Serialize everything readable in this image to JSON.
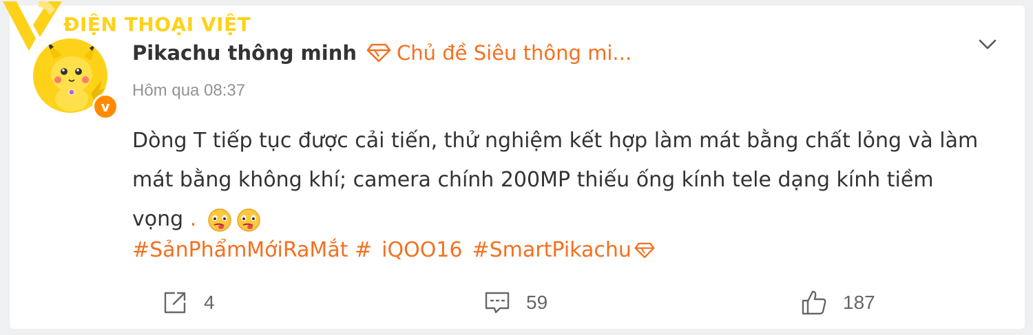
{
  "watermark": {
    "text": "ĐIỆN THOẠI VIỆT"
  },
  "post": {
    "username": "Pikachu thông minh",
    "topic": "Chủ đề Siêu thông mi...",
    "timestamp": "Hôm qua 08:37",
    "verified_badge": "v",
    "body_lines": [
      "Dòng T tiếp tục được cải tiến, thử nghiệm kết hợp làm mát bằng chất lỏng và làm",
      "mát bằng không khí; camera chính 200MP thiếu ống kính tele dạng kính tiềm",
      "vọng"
    ],
    "body_trailing_dot": ".",
    "hashtags": [
      "#SảnPhẩmMớiRaMắt #",
      "iQOO16",
      "#SmartPikachu"
    ]
  },
  "actions": {
    "share_count": "4",
    "comment_count": "59",
    "like_count": "187"
  },
  "colors": {
    "accent": "#f4701f",
    "watermark": "#ffd21a",
    "avatar_bg": "#ffd21a"
  },
  "icons": [
    "chevron-down-icon",
    "diamond-icon",
    "share-icon",
    "comment-icon",
    "like-icon",
    "emoji-icon"
  ]
}
